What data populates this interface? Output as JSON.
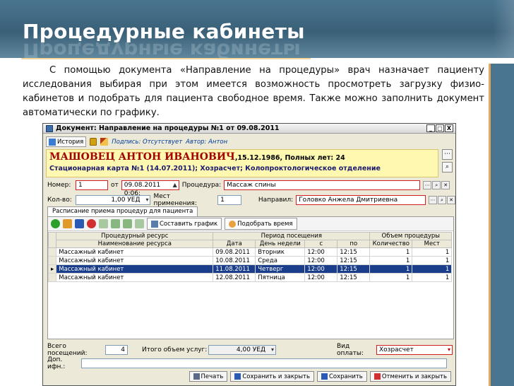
{
  "slide": {
    "title": "Процедурные кабинеты",
    "body": "С помощью документа «Направление на процедуры» врач назначает пациенту исследования выбирая при этом имеется возможность просмотреть загрузку физио-кабинетов и подобрать для пациента свободное время. Также можно заполнить документ автоматически по графику."
  },
  "colors": {
    "title_bar": "#3a6078",
    "accent": "#f3d59a",
    "selected_row": "#1b3e8a",
    "patient_name": "#a40000"
  },
  "window": {
    "title": "Документ: Направление на процедуры №1 от 09.08.2011",
    "controls": [
      "_",
      "□",
      "X"
    ],
    "toolbar": {
      "history_label": "История",
      "signature_label": "Подпись: Отсутствует",
      "author_label": "Автор: Антон"
    },
    "patient": {
      "name": "МАШОВЕЦ АНТОН ИВАНОВИЧ",
      "details": ",15.12.1986, Полных лет: 24",
      "card": "Стационарная карта №1 (14.07.2011); Хозрасчет; Колопроктологическое отделение"
    },
    "form": {
      "number_label": "Номер:",
      "number_value": "1",
      "from_label": "от",
      "date_value": "09.08.2011 0:06:",
      "procedure_label": "Процедура:",
      "procedure_value": "Массаж спины",
      "qty_label": "Кол-во:",
      "qty_value": "1,00 УЕД",
      "places_label": "Мест применения:",
      "places_value": "1",
      "referrer_label": "Направил:",
      "referrer_value": "Головко Анжела Дмитриевна"
    },
    "tab_label": "Расписание приема процедур для пациента",
    "grid_buttons": {
      "schedule": "Составить график",
      "pick_time": "Подобрать время"
    },
    "table": {
      "group_headers": {
        "resource": "Процедурный ресурс",
        "period": "Период посещения",
        "volume": "Объем процедуры"
      },
      "headers": [
        "Наименование ресурса",
        "Дата",
        "День недели",
        "с",
        "по",
        "Количество",
        "Мест"
      ],
      "rows": [
        [
          "Массажный кабинет",
          "09.08.2011",
          "Вторник",
          "12:00",
          "12:15",
          "1",
          "1"
        ],
        [
          "Массажный кабинет",
          "10.08.2011",
          "Среда",
          "12:00",
          "12:15",
          "1",
          "1"
        ],
        [
          "Массажный кабинет",
          "11.08.2011",
          "Четверг",
          "12:00",
          "12:15",
          "1",
          "1"
        ],
        [
          "Массажный кабинет",
          "12.08.2011",
          "Пятница",
          "12:00",
          "12:15",
          "1",
          "1"
        ]
      ],
      "selected_row": 2
    },
    "footer": {
      "visits_label": "Всего посещений:",
      "visits_value": "4",
      "total_label": "Итого объем услуг:",
      "total_value": "4,00 УЕД",
      "payment_label": "Вид оплаты:",
      "payment_value": "Хозрасчет",
      "extra_label": "Доп. ифн.:"
    },
    "buttons": {
      "print": "Печать",
      "save_close": "Сохранить и закрыть",
      "save": "Сохранить",
      "cancel_close": "Отменить и закрыть"
    }
  }
}
